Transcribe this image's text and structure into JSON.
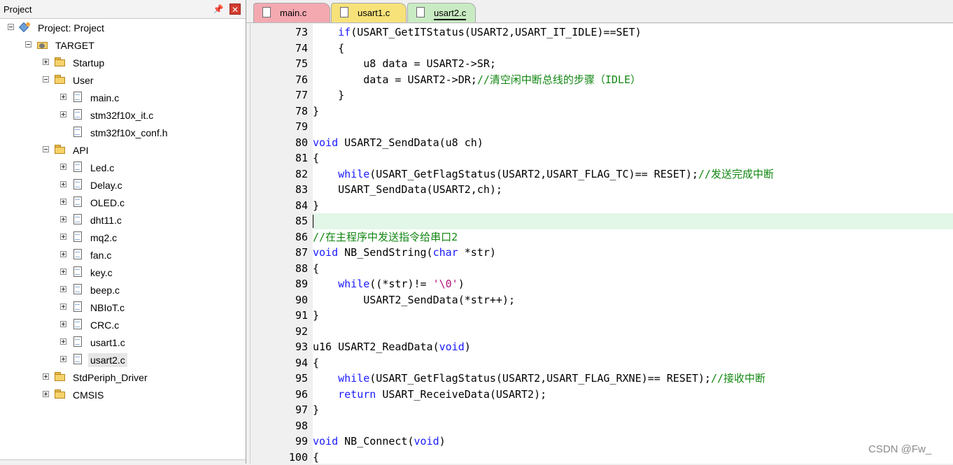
{
  "project_panel": {
    "title": "Project",
    "tree": [
      {
        "label": "Project: Project",
        "icon": "project-icon",
        "level": 0,
        "expander": "minus"
      },
      {
        "label": "TARGET",
        "icon": "target-icon",
        "level": 1,
        "expander": "minus"
      },
      {
        "label": "Startup",
        "icon": "folder-icon",
        "level": 2,
        "expander": "plus"
      },
      {
        "label": "User",
        "icon": "folder-icon",
        "level": 2,
        "expander": "minus"
      },
      {
        "label": "main.c",
        "icon": "file-icon",
        "level": 3,
        "expander": "plus"
      },
      {
        "label": "stm32f10x_it.c",
        "icon": "file-icon",
        "level": 3,
        "expander": "plus"
      },
      {
        "label": "stm32f10x_conf.h",
        "icon": "file-icon",
        "level": 3,
        "expander": "none"
      },
      {
        "label": "API",
        "icon": "folder-icon",
        "level": 2,
        "expander": "minus"
      },
      {
        "label": "Led.c",
        "icon": "file-icon",
        "level": 3,
        "expander": "plus"
      },
      {
        "label": "Delay.c",
        "icon": "file-icon",
        "level": 3,
        "expander": "plus"
      },
      {
        "label": "OLED.c",
        "icon": "file-icon",
        "level": 3,
        "expander": "plus"
      },
      {
        "label": "dht11.c",
        "icon": "file-icon",
        "level": 3,
        "expander": "plus"
      },
      {
        "label": "mq2.c",
        "icon": "file-icon",
        "level": 3,
        "expander": "plus"
      },
      {
        "label": "fan.c",
        "icon": "file-icon",
        "level": 3,
        "expander": "plus"
      },
      {
        "label": "key.c",
        "icon": "file-icon",
        "level": 3,
        "expander": "plus"
      },
      {
        "label": "beep.c",
        "icon": "file-icon",
        "level": 3,
        "expander": "plus"
      },
      {
        "label": "NBIoT.c",
        "icon": "file-icon",
        "level": 3,
        "expander": "plus"
      },
      {
        "label": "CRC.c",
        "icon": "file-icon",
        "level": 3,
        "expander": "plus"
      },
      {
        "label": "usart1.c",
        "icon": "file-icon",
        "level": 3,
        "expander": "plus"
      },
      {
        "label": "usart2.c",
        "icon": "file-icon",
        "level": 3,
        "expander": "plus",
        "selected": true
      },
      {
        "label": "StdPeriph_Driver",
        "icon": "folder-icon",
        "level": 2,
        "expander": "plus"
      },
      {
        "label": "CMSIS",
        "icon": "folder-icon",
        "level": 2,
        "expander": "plus"
      }
    ]
  },
  "editor": {
    "tabs": [
      {
        "label": "main.c",
        "color": "#f4a9b1",
        "active": false
      },
      {
        "label": "usart1.c",
        "color": "#f7e27a",
        "active": false
      },
      {
        "label": "usart2.c",
        "color": "#c9ebc3",
        "active": true
      }
    ],
    "current_line": 85,
    "lines": [
      {
        "n": "73",
        "tokens": [
          [
            "    ",
            ""
          ],
          [
            "if",
            "kw"
          ],
          [
            "(USART_GetITStatus(USART2,USART_IT_IDLE)==SET)",
            ""
          ]
        ]
      },
      {
        "n": "74",
        "tokens": [
          [
            "    {",
            ""
          ]
        ]
      },
      {
        "n": "75",
        "tokens": [
          [
            "        u8 data = USART2->SR;",
            ""
          ]
        ]
      },
      {
        "n": "76",
        "tokens": [
          [
            "        data = USART2->DR;",
            ""
          ],
          [
            "//清空闲中断总线的步骤（IDLE）",
            "cm"
          ]
        ]
      },
      {
        "n": "77",
        "tokens": [
          [
            "    }",
            ""
          ]
        ]
      },
      {
        "n": "78",
        "tokens": [
          [
            "}",
            ""
          ]
        ]
      },
      {
        "n": "79",
        "tokens": []
      },
      {
        "n": "80",
        "tokens": [
          [
            "void",
            "kw"
          ],
          [
            " USART2_SendData(u8 ch)",
            ""
          ]
        ]
      },
      {
        "n": "81",
        "tokens": [
          [
            "{",
            ""
          ]
        ]
      },
      {
        "n": "82",
        "tokens": [
          [
            "    ",
            ""
          ],
          [
            "while",
            "kw"
          ],
          [
            "(USART_GetFlagStatus(USART2,USART_FLAG_TC)== RESET);",
            ""
          ],
          [
            "//发送完成中断",
            "cm"
          ]
        ]
      },
      {
        "n": "83",
        "tokens": [
          [
            "    USART_SendData(USART2,ch);",
            ""
          ]
        ]
      },
      {
        "n": "84",
        "tokens": [
          [
            "}",
            ""
          ]
        ]
      },
      {
        "n": "85",
        "tokens": []
      },
      {
        "n": "86",
        "tokens": [
          [
            "//在主程序中发送指令给串口2",
            "cm"
          ]
        ]
      },
      {
        "n": "87",
        "tokens": [
          [
            "void",
            "kw"
          ],
          [
            " NB_SendString(",
            ""
          ],
          [
            "char",
            "kw"
          ],
          [
            " *str)",
            ""
          ]
        ]
      },
      {
        "n": "88",
        "tokens": [
          [
            "{",
            ""
          ]
        ]
      },
      {
        "n": "89",
        "tokens": [
          [
            "    ",
            ""
          ],
          [
            "while",
            "kw"
          ],
          [
            "((*str)!= ",
            ""
          ],
          [
            "'\\0'",
            "str"
          ],
          [
            ")",
            ""
          ]
        ]
      },
      {
        "n": "90",
        "tokens": [
          [
            "        USART2_SendData(*str++);",
            ""
          ]
        ]
      },
      {
        "n": "91",
        "tokens": [
          [
            "}",
            ""
          ]
        ]
      },
      {
        "n": "92",
        "tokens": []
      },
      {
        "n": "93",
        "tokens": [
          [
            "u16 USART2_ReadData(",
            ""
          ],
          [
            "void",
            "kw"
          ],
          [
            ")",
            ""
          ]
        ]
      },
      {
        "n": "94",
        "tokens": [
          [
            "{",
            ""
          ]
        ]
      },
      {
        "n": "95",
        "tokens": [
          [
            "    ",
            ""
          ],
          [
            "while",
            "kw"
          ],
          [
            "(USART_GetFlagStatus(USART2,USART_FLAG_RXNE)== RESET);",
            ""
          ],
          [
            "//接收中断",
            "cm"
          ]
        ]
      },
      {
        "n": "96",
        "tokens": [
          [
            "    ",
            ""
          ],
          [
            "return",
            "kw"
          ],
          [
            " USART_ReceiveData(USART2);",
            ""
          ]
        ]
      },
      {
        "n": "97",
        "tokens": [
          [
            "}",
            ""
          ]
        ]
      },
      {
        "n": "98",
        "tokens": []
      },
      {
        "n": "99",
        "tokens": [
          [
            "void",
            "kw"
          ],
          [
            " NB_Connect(",
            ""
          ],
          [
            "void",
            "kw"
          ],
          [
            ")",
            ""
          ]
        ]
      },
      {
        "n": "100",
        "tokens": [
          [
            "{",
            ""
          ]
        ]
      }
    ]
  },
  "watermark": "CSDN @Fw_"
}
